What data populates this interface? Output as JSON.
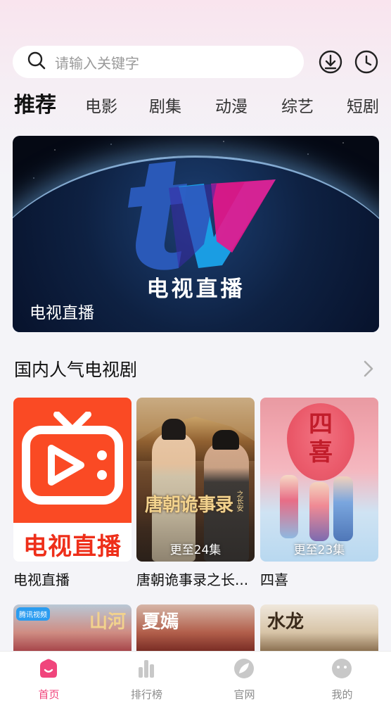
{
  "search": {
    "placeholder": "请输入关键字"
  },
  "header_icons": [
    "download-icon",
    "history-clock-icon"
  ],
  "tabs": [
    {
      "label": "推荐",
      "active": true
    },
    {
      "label": "电影",
      "active": false
    },
    {
      "label": "剧集",
      "active": false
    },
    {
      "label": "动漫",
      "active": false
    },
    {
      "label": "综艺",
      "active": false
    },
    {
      "label": "短剧",
      "active": false
    }
  ],
  "hero": {
    "logo_text": "电视直播",
    "caption": "电视直播"
  },
  "section": {
    "title": "国内人气电视剧"
  },
  "cards": [
    {
      "title": "电视直播",
      "badge": "",
      "poster_text": "电视直播"
    },
    {
      "title": "唐朝诡事录之长...",
      "badge": "更至24集",
      "poster_text": "唐朝诡事录",
      "poster_sub": "之长安"
    },
    {
      "title": "四喜",
      "badge": "更至23集",
      "poster_text": "四喜"
    }
  ],
  "row2": [
    {
      "tag": "腾讯视频",
      "text": "山河"
    },
    {
      "tag": "",
      "text": "夏嫣"
    },
    {
      "tag": "",
      "text": "水龙"
    }
  ],
  "bottom_nav": [
    {
      "label": "首页",
      "icon": "home-icon",
      "active": true
    },
    {
      "label": "排行榜",
      "icon": "bar-chart-icon",
      "active": false
    },
    {
      "label": "官网",
      "icon": "leaf-icon",
      "active": false
    },
    {
      "label": "我的",
      "icon": "smiley-face-icon",
      "active": false
    }
  ],
  "colors": {
    "accent": "#f0457c",
    "live_red": "#fa4a24"
  }
}
